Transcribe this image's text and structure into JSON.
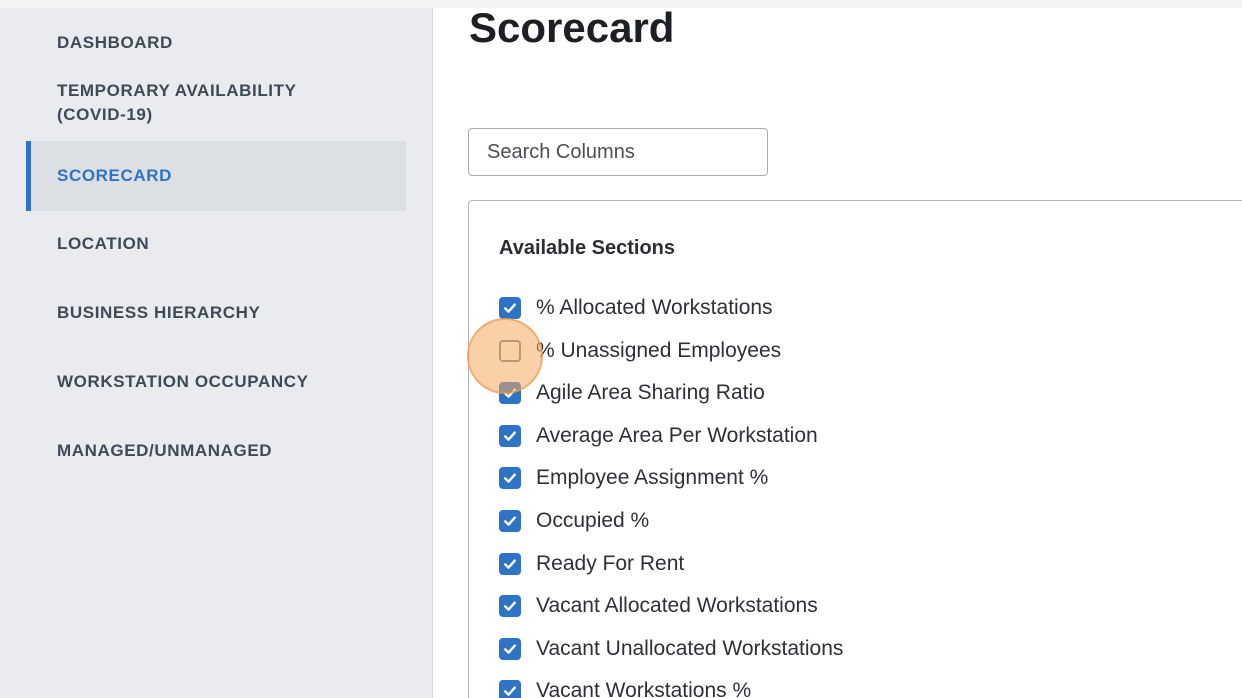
{
  "sidebar": {
    "items": [
      {
        "label": "DASHBOARD"
      },
      {
        "label": "TEMPORARY AVAILABILITY",
        "label_line2": "(COVID-19)"
      },
      {
        "label": "SCORECARD"
      },
      {
        "label": "LOCATION"
      },
      {
        "label": "BUSINESS HIERARCHY"
      },
      {
        "label": "WORKSTATION OCCUPANCY"
      },
      {
        "label": "MANAGED/UNMANAGED"
      }
    ],
    "active_index": 2
  },
  "main": {
    "title": "Scorecard",
    "search": {
      "placeholder": "Search Columns",
      "value": ""
    },
    "sections_title": "Available Sections",
    "sections": [
      {
        "label": "% Allocated Workstations",
        "checked": true
      },
      {
        "label": "% Unassigned Employees",
        "checked": false
      },
      {
        "label": "Agile Area Sharing Ratio",
        "checked": true
      },
      {
        "label": "Average Area Per Workstation",
        "checked": true
      },
      {
        "label": "Employee Assignment %",
        "checked": true
      },
      {
        "label": "Occupied %",
        "checked": true
      },
      {
        "label": "Ready For Rent",
        "checked": true
      },
      {
        "label": "Vacant Allocated Workstations",
        "checked": true
      },
      {
        "label": "Vacant Unallocated Workstations",
        "checked": true
      },
      {
        "label": "Vacant Workstations %",
        "checked": true
      }
    ]
  },
  "colors": {
    "accent": "#2f73c5",
    "sidebar_bg": "#e9ebee",
    "highlight": "#f6aa60"
  }
}
